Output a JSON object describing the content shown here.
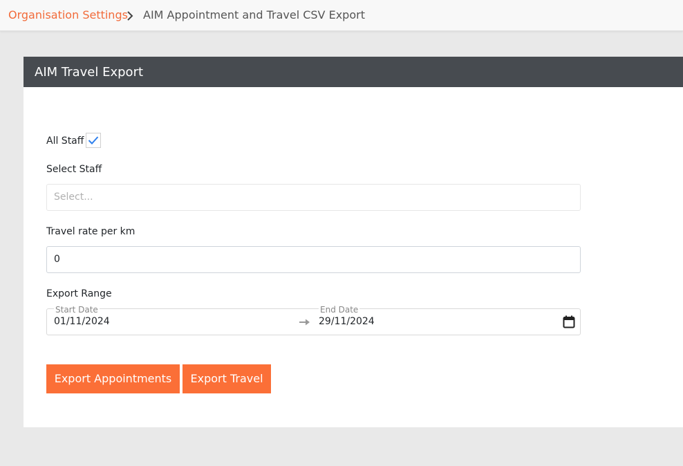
{
  "breadcrumb": {
    "parent_label": "Organisation Settings",
    "current_label": "AIM Appointment and Travel CSV Export"
  },
  "card": {
    "title": "AIM Travel Export"
  },
  "form": {
    "all_staff_label": "All Staff",
    "all_staff_checked": true,
    "select_staff_label": "Select Staff",
    "select_staff_placeholder": "Select...",
    "travel_rate_label": "Travel rate per km",
    "travel_rate_value": "0",
    "export_range_label": "Export Range",
    "start_date_label": "Start Date",
    "start_date_value": "01/11/2024",
    "end_date_label": "End Date",
    "end_date_value": "29/11/2024"
  },
  "actions": {
    "export_appointments_label": "Export Appointments",
    "export_travel_label": "Export Travel"
  },
  "colors": {
    "accent": "#fb6f37",
    "link": "#f26b3a",
    "header_bg": "#474b50",
    "checkmark": "#2f80ed"
  },
  "icons": {
    "breadcrumb_separator": "chevron-right-icon",
    "checkbox": "check-icon",
    "range_separator": "arrow-right-icon",
    "date_picker": "calendar-icon"
  }
}
